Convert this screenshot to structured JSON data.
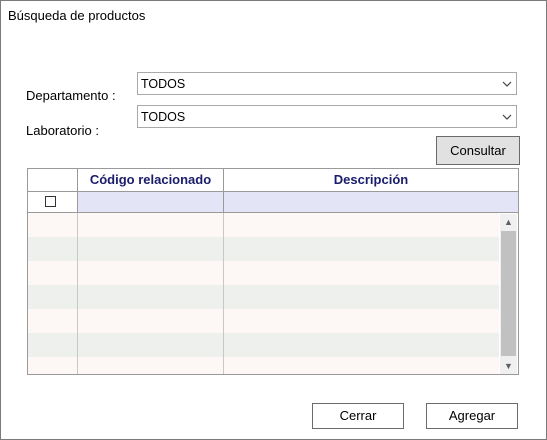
{
  "window": {
    "title": "Búsqueda de productos"
  },
  "form": {
    "departamento_label": "Departamento :",
    "departamento_value": "TODOS",
    "laboratorio_label": "Laboratorio :",
    "laboratorio_value": "TODOS",
    "consultar_label": "Consultar"
  },
  "grid": {
    "columns": [
      "",
      "Código relacionado",
      "Descripción"
    ],
    "header_color": "#1a1d6b",
    "filter_row_color": "#e3e5f6",
    "row_colors": [
      "#fdf8f6",
      "#eef0ed"
    ]
  },
  "footer": {
    "cerrar_label": "Cerrar",
    "agregar_label": "Agregar"
  },
  "icons": {
    "dropdown": "chevron-down-icon",
    "scroll_up": "arrow-up-icon",
    "scroll_down": "arrow-down-icon"
  }
}
